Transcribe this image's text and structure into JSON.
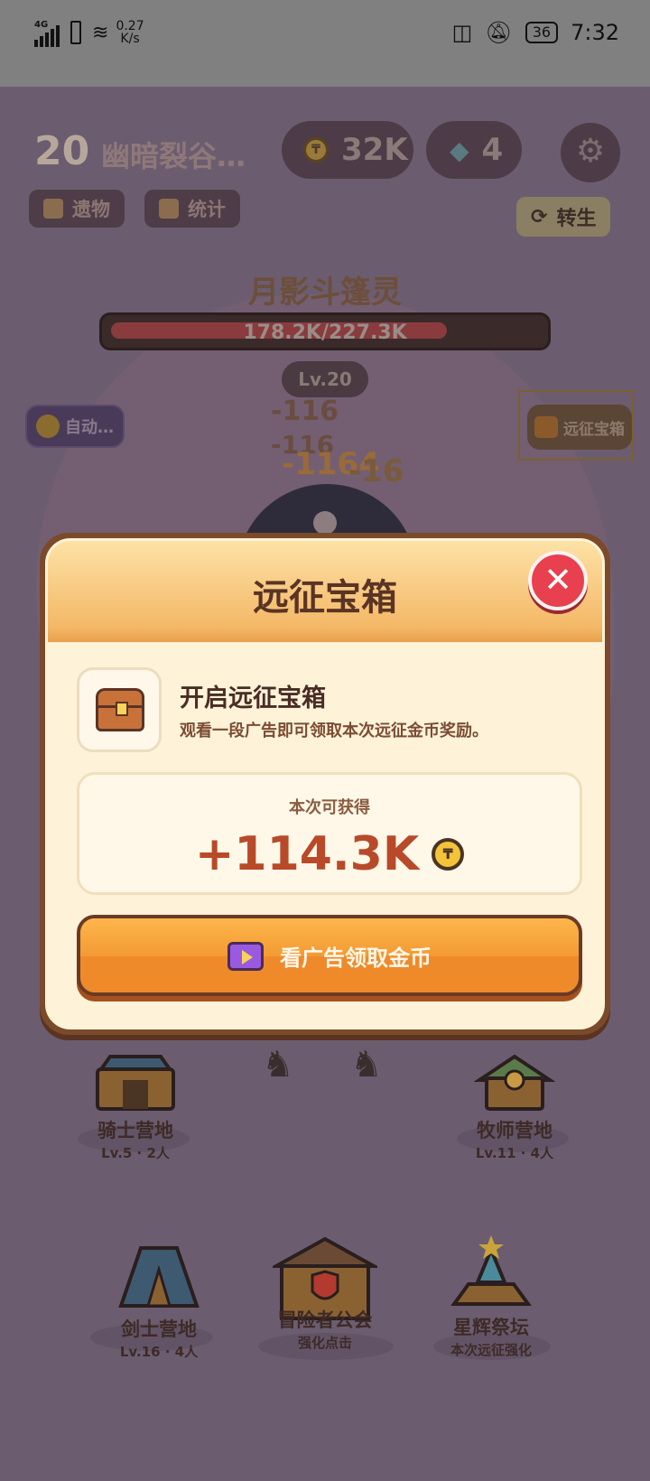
{
  "status_bar": {
    "network": "4G",
    "speed_value": "0.27",
    "speed_unit": "K/s",
    "battery": "36",
    "time": "7:32"
  },
  "hud": {
    "level": "20",
    "zone": "幽暗裂谷…",
    "gold": "32K",
    "gems": "4",
    "relics_label": "遗物",
    "stats_label": "统计",
    "rebirth_label": "转生"
  },
  "boss": {
    "name": "月影斗篷灵",
    "hp_text": "178.2K/227.3K",
    "hp_fraction": 0.784,
    "level": "Lv.20"
  },
  "side": {
    "auto_label": "自动…",
    "chest_label": "远征宝箱"
  },
  "damage_numbers": [
    "-116",
    "-116",
    "-1164",
    "-16"
  ],
  "buildings": [
    {
      "name": "骑士营地",
      "info": "Lv.5 · 2人"
    },
    {
      "name": "牧师营地",
      "info": "Lv.11 · 4人"
    },
    {
      "name": "剑士营地",
      "info": "Lv.16 · 4人"
    },
    {
      "name": "冒险者公会",
      "info": "强化点击"
    },
    {
      "name": "星辉祭坛",
      "info": "本次远征强化"
    }
  ],
  "modal": {
    "title": "远征宝箱",
    "heading": "开启远征宝箱",
    "description": "观看一段广告即可领取本次远征金币奖励。",
    "reward_label": "本次可获得",
    "reward_value": "+114.3K",
    "button_label": "看广告领取金币"
  },
  "icons": {
    "close": "close-icon",
    "chest": "chest-icon",
    "coin": "coin-icon",
    "ad": "video-ad-icon",
    "settings": "gear-icon"
  },
  "colors": {
    "accent_orange": "#ef8a2a",
    "close_red": "#e8404e",
    "reward_text": "#b84a2a"
  }
}
